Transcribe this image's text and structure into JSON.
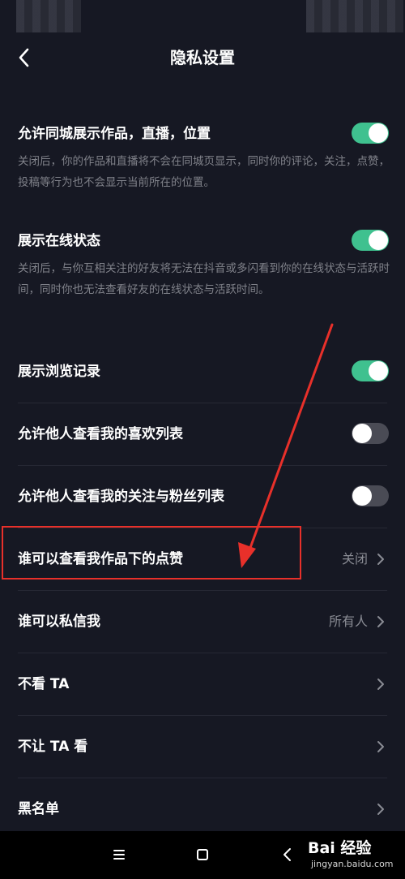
{
  "header": {
    "title": "隐私设置",
    "back_icon": "chevron-left-icon"
  },
  "settings": [
    {
      "title": "允许同城展示作品，直播，位置",
      "description": "关闭后，你的作品和直播将不会在同城页显示，同时你的评论，关注，点赞，投稿等行为也不会显示当前所在的位置。",
      "control": "toggle",
      "state": "on"
    },
    {
      "title": "展示在线状态",
      "description": "关闭后，与你互相关注的好友将无法在抖音或多闪看到你的在线状态与活跃时间，同时你也无法查看好友的在线状态与活跃时间。",
      "control": "toggle",
      "state": "on"
    },
    {
      "title": "展示浏览记录",
      "control": "toggle",
      "state": "on"
    },
    {
      "title": "允许他人查看我的喜欢列表",
      "control": "toggle",
      "state": "off"
    },
    {
      "title": "允许他人查看我的关注与粉丝列表",
      "control": "toggle",
      "state": "off"
    },
    {
      "title": "谁可以查看我作品下的点赞",
      "value": "关闭",
      "control": "link"
    },
    {
      "title": "谁可以私信我",
      "value": "所有人",
      "control": "link"
    },
    {
      "title": "不看 TA",
      "control": "link"
    },
    {
      "title": "不让 TA 看",
      "control": "link"
    },
    {
      "title": "黑名单",
      "control": "link"
    }
  ],
  "colors": {
    "background": "#161823",
    "toggle_on": "#3fc18f",
    "toggle_off": "#4a4b55",
    "annotation": "#e8302a",
    "secondary_text": "#80828a"
  },
  "system_nav": {
    "icons": [
      "menu-icon",
      "home-square-icon",
      "back-triangle-icon"
    ]
  },
  "watermark": {
    "logo": "Bai 经验",
    "url": "jingyan.baidu.com"
  }
}
